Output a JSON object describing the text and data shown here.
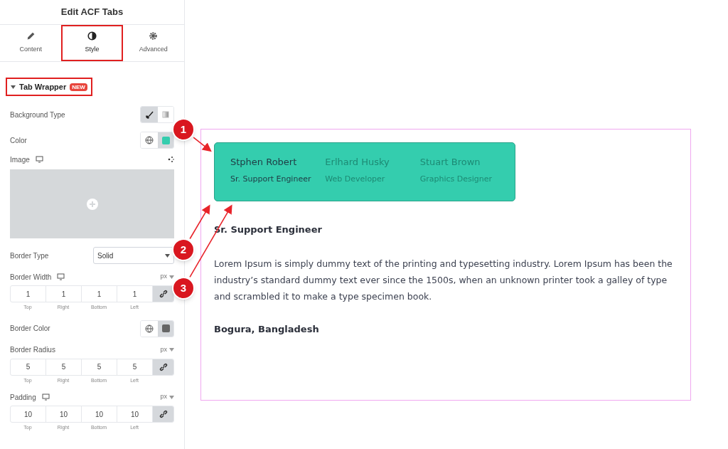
{
  "panel": {
    "title": "Edit ACF Tabs",
    "tabs": [
      {
        "label": "Content",
        "selected": false
      },
      {
        "label": "Style",
        "selected": true
      },
      {
        "label": "Advanced",
        "selected": false
      }
    ],
    "section": {
      "title": "Tab Wrapper",
      "badge": "NEW",
      "expanded": true,
      "highlighted": true
    },
    "controls": [
      {
        "kind": "toggle2",
        "label": "Background Type"
      },
      {
        "kind": "color",
        "label": "Color",
        "color": "#34cdae"
      },
      {
        "kind": "image",
        "label": "Image"
      },
      {
        "kind": "select",
        "label": "Border Type",
        "value": "Solid"
      },
      {
        "kind": "dims",
        "label": "Border Width",
        "unit": "px",
        "responsive": true,
        "values": [
          "1",
          "1",
          "1",
          "1"
        ],
        "sides": [
          "Top",
          "Right",
          "Bottom",
          "Left"
        ]
      },
      {
        "kind": "color",
        "label": "Border Color",
        "color": "#666666"
      },
      {
        "kind": "dims",
        "label": "Border Radius",
        "unit": "px",
        "responsive": false,
        "values": [
          "5",
          "5",
          "5",
          "5"
        ],
        "sides": [
          "Top",
          "Right",
          "Bottom",
          "Left"
        ]
      },
      {
        "kind": "dims",
        "label": "Padding",
        "unit": "px",
        "responsive": true,
        "values": [
          "10",
          "10",
          "10",
          "10"
        ],
        "sides": [
          "Top",
          "Right",
          "Bottom",
          "Left"
        ]
      }
    ]
  },
  "preview": {
    "tabs": [
      {
        "name": "Stphen Robert",
        "role": "Sr. Support Engineer",
        "selected": true
      },
      {
        "name": "Erlhard Husky",
        "role": "Web Developer",
        "selected": false
      },
      {
        "name": "Stuart Brown",
        "role": "Graphics Designer",
        "selected": false
      }
    ],
    "heading": "Sr. Support Engineer",
    "body": "Lorem Ipsum is simply dummy text of the printing and typesetting industry. Lorem Ipsum has been the industry’s standard dummy text ever since the 1500s, when an unknown printer took a galley of type and scrambled it to make a type specimen book.",
    "location": "Bogura, Bangladesh"
  },
  "callouts": [
    "1",
    "2",
    "3"
  ]
}
